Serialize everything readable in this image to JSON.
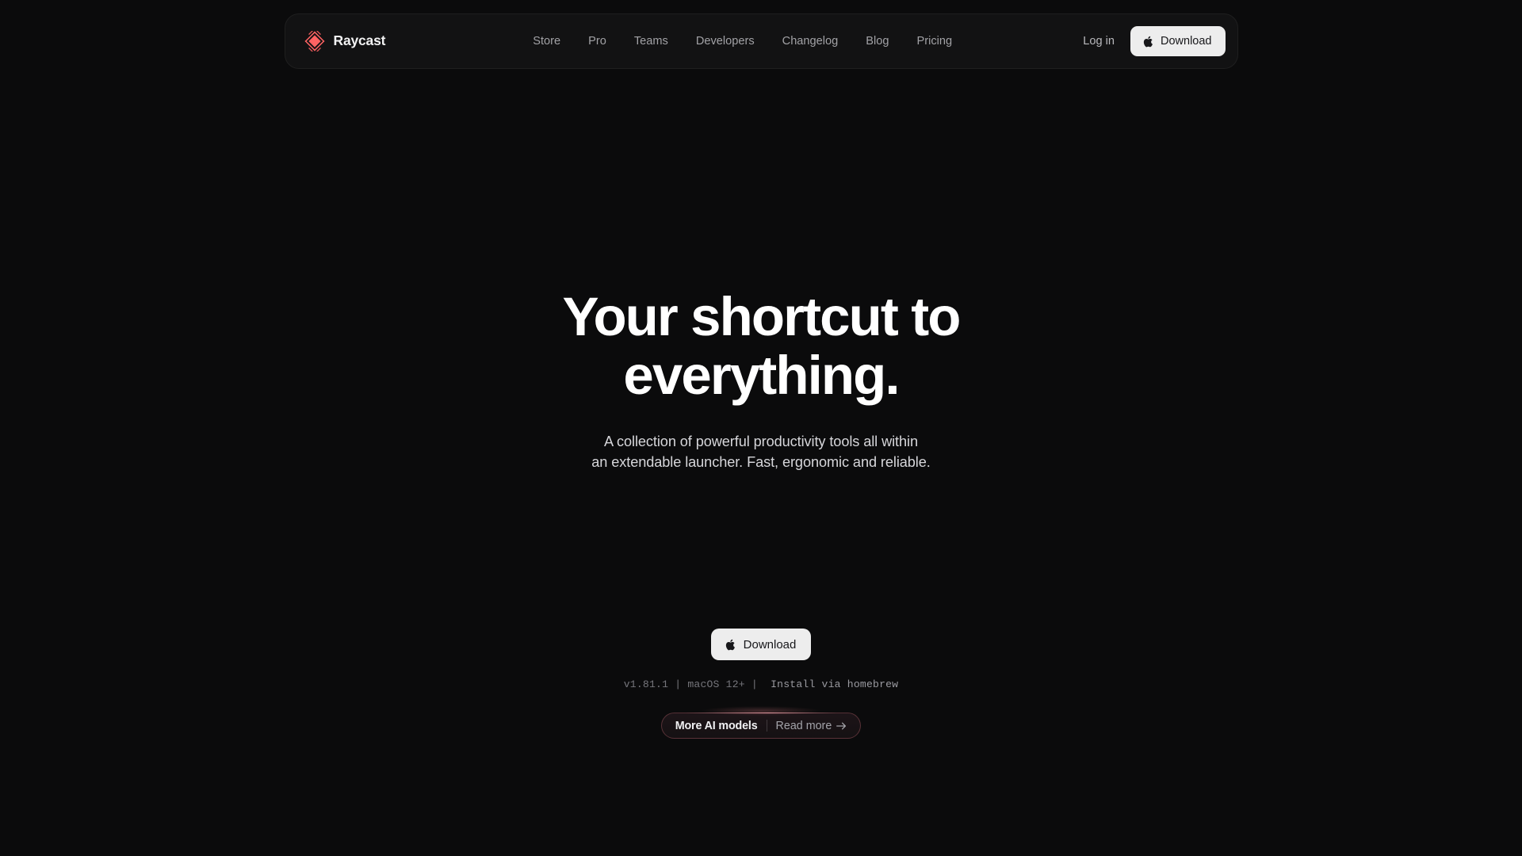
{
  "site": {
    "background_color": "#0b0b0c",
    "accent_color": "#ff6363"
  },
  "navbar": {
    "brand": {
      "name": "Raycast",
      "logo_icon": "raycast-logo-icon",
      "logo_color": "#ff6363"
    },
    "links": [
      {
        "label": "Store"
      },
      {
        "label": "Pro"
      },
      {
        "label": "Teams"
      },
      {
        "label": "Developers"
      },
      {
        "label": "Changelog"
      },
      {
        "label": "Blog"
      },
      {
        "label": "Pricing"
      }
    ],
    "login_label": "Log in",
    "download_label": "Download",
    "download_icon": "apple-icon"
  },
  "hero": {
    "title_line1": "Your shortcut to",
    "title_line2": "everything.",
    "subtitle_line1": "A collection of powerful productivity tools all within",
    "subtitle_line2": "an extendable launcher. Fast, ergonomic and reliable.",
    "cta_label": "Download",
    "cta_icon": "apple-icon",
    "meta": {
      "version": "v1.81.1",
      "separator_1": " | ",
      "platform": "macOS 12+",
      "separator_2": " |  ",
      "homebrew_label": "Install via homebrew"
    },
    "badge": {
      "title": "More AI models",
      "cta": "Read more",
      "arrow_icon": "arrow-right-icon",
      "border_color": "#e77a86"
    }
  }
}
